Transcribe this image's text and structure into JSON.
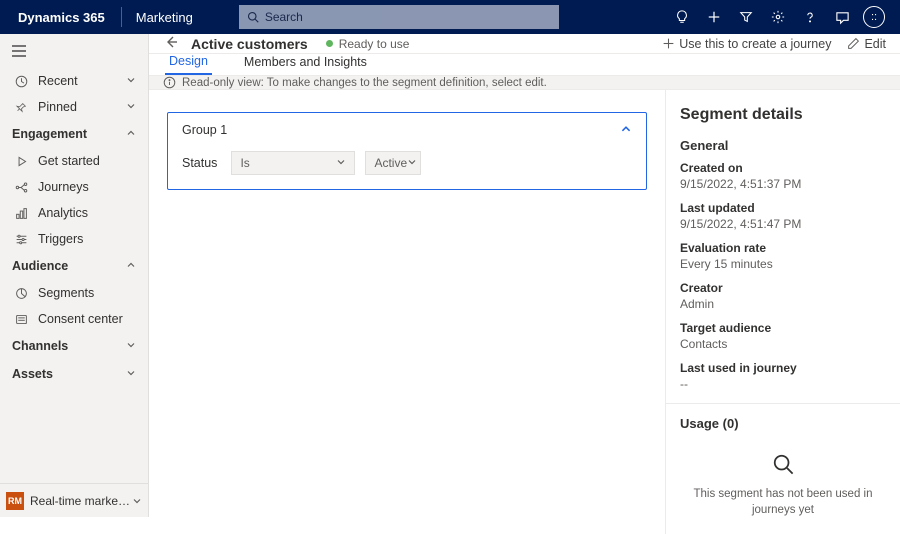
{
  "topbar": {
    "brand": "Dynamics 365",
    "module": "Marketing",
    "search_placeholder": "Search",
    "avatar_char": "::"
  },
  "sidebar": {
    "recent": "Recent",
    "pinned": "Pinned",
    "groups": {
      "engagement": "Engagement",
      "audience": "Audience",
      "channels": "Channels",
      "assets": "Assets"
    },
    "items": {
      "get_started": "Get started",
      "journeys": "Journeys",
      "analytics": "Analytics",
      "triggers": "Triggers",
      "segments": "Segments",
      "consent_center": "Consent center"
    },
    "area": {
      "badge": "RM",
      "label": "Real-time marketi…"
    }
  },
  "header": {
    "title": "Active customers",
    "status": "Ready to use",
    "create_journey": "Use this to create a journey",
    "edit": "Edit"
  },
  "tabs": {
    "design": "Design",
    "members": "Members and Insights"
  },
  "info_bar": "Read-only view: To make changes to the segment definition, select edit.",
  "group": {
    "title": "Group 1",
    "attribute": "Status",
    "operator": "Is",
    "value": "Active"
  },
  "details": {
    "title": "Segment details",
    "general": "General",
    "fields": {
      "created_on": {
        "k": "Created on",
        "v": "9/15/2022, 4:51:37 PM"
      },
      "last_updated": {
        "k": "Last updated",
        "v": "9/15/2022, 4:51:47 PM"
      },
      "evaluation_rate": {
        "k": "Evaluation rate",
        "v": "Every 15 minutes"
      },
      "creator": {
        "k": "Creator",
        "v": "Admin"
      },
      "target_audience": {
        "k": "Target audience",
        "v": "Contacts"
      },
      "last_used": {
        "k": "Last used in journey",
        "v": "--"
      }
    },
    "usage_title": "Usage (0)",
    "usage_empty": "This segment has not been used in journeys yet"
  }
}
